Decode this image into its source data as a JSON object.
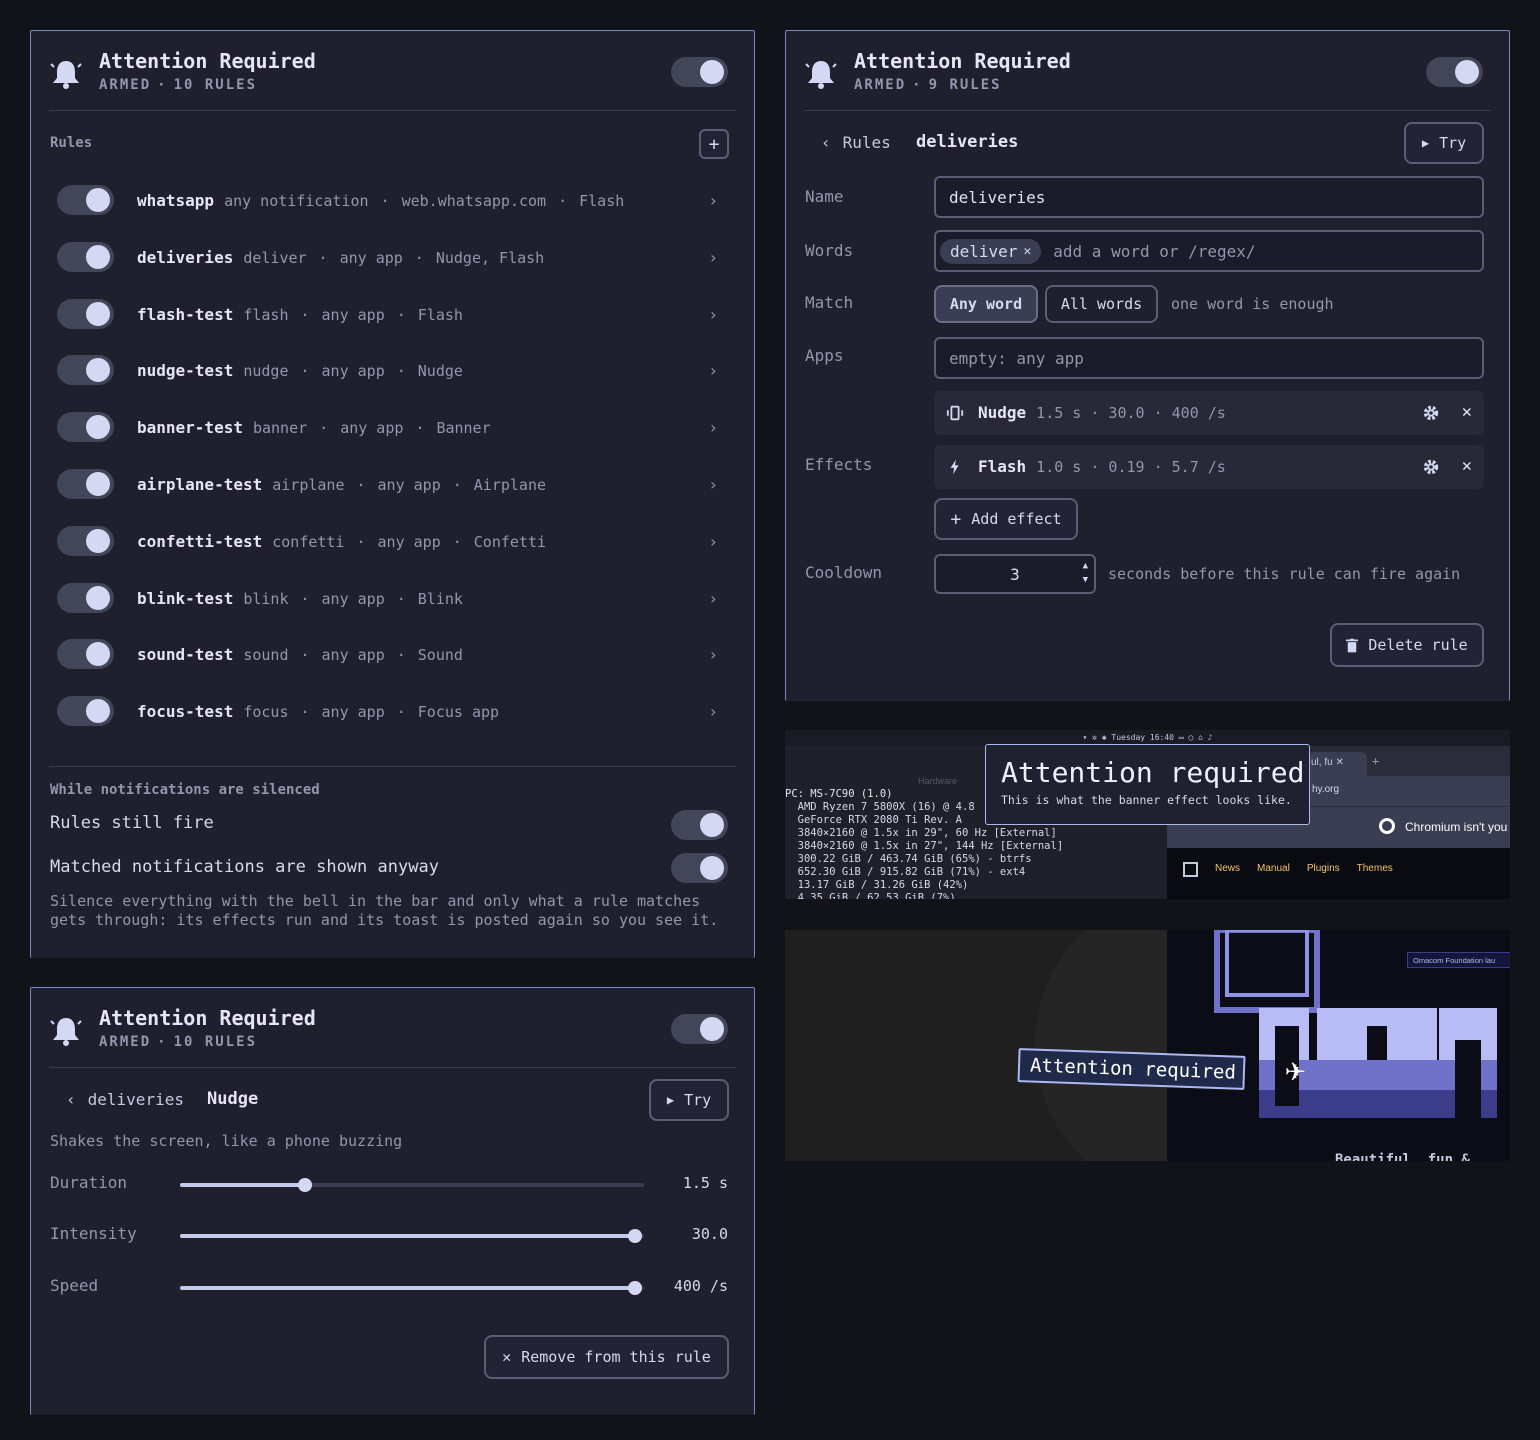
{
  "panel_rules": {
    "title": "Attention Required",
    "status": "ARMED",
    "rule_count": "10 RULES",
    "section_label": "Rules",
    "add_icon": "plus-icon",
    "rules": [
      {
        "name": "whatsapp",
        "trigger": "any notification",
        "app": "web.whatsapp.com",
        "effects": "Flash"
      },
      {
        "name": "deliveries",
        "trigger": "deliver",
        "app": "any app",
        "effects": "Nudge, Flash"
      },
      {
        "name": "flash-test",
        "trigger": "flash",
        "app": "any app",
        "effects": "Flash"
      },
      {
        "name": "nudge-test",
        "trigger": "nudge",
        "app": "any app",
        "effects": "Nudge"
      },
      {
        "name": "banner-test",
        "trigger": "banner",
        "app": "any app",
        "effects": "Banner"
      },
      {
        "name": "airplane-test",
        "trigger": "airplane",
        "app": "any app",
        "effects": "Airplane"
      },
      {
        "name": "confetti-test",
        "trigger": "confetti",
        "app": "any app",
        "effects": "Confetti"
      },
      {
        "name": "blink-test",
        "trigger": "blink",
        "app": "any app",
        "effects": "Blink"
      },
      {
        "name": "sound-test",
        "trigger": "sound",
        "app": "any app",
        "effects": "Sound"
      },
      {
        "name": "focus-test",
        "trigger": "focus",
        "app": "any app",
        "effects": "Focus app"
      }
    ],
    "silenced_header": "While notifications are silenced",
    "silenced_opt1": "Rules still fire",
    "silenced_opt2": "Matched notifications are shown anyway",
    "silenced_note_1": "Silence everything with the bell in the bar and only what a rule matches",
    "silenced_note_2": "gets through: its effects run and its toast is posted again so you see it."
  },
  "panel_edit": {
    "title": "Attention Required",
    "status": "ARMED",
    "rule_count": "9 RULES",
    "back_label": "Rules",
    "rule_name": "deliveries",
    "try_label": "Try",
    "name_label": "Name",
    "name_value": "deliveries",
    "words_label": "Words",
    "word_chip": "deliver",
    "words_placeholder": "add a word or /regex/",
    "match_label": "Match",
    "match_any": "Any word",
    "match_all": "All words",
    "match_hint": "one word is enough",
    "apps_label": "Apps",
    "apps_placeholder": "empty: any app",
    "effects_label": "Effects",
    "effects": [
      {
        "name": "Nudge",
        "params": "1.5 s · 30.0 · 400 /s",
        "icon": "vibrate-icon"
      },
      {
        "name": "Flash",
        "params": "1.0 s · 0.19 · 5.7 /s",
        "icon": "bolt-icon"
      }
    ],
    "add_effect": "Add effect",
    "cooldown_label": "Cooldown",
    "cooldown_value": "3",
    "cooldown_hint": "seconds before this rule can fire again",
    "delete_label": "Delete rule"
  },
  "panel_effect": {
    "title": "Attention Required",
    "status": "ARMED",
    "rule_count": "10 RULES",
    "back_label": "deliveries",
    "effect_name": "Nudge",
    "try_label": "Try",
    "description": "Shakes the screen, like a phone buzzing",
    "duration_label": "Duration",
    "duration_value": "1.5 s",
    "duration_level": 0.27,
    "intensity_label": "Intensity",
    "intensity_value": "30.0",
    "intensity_level": 0.98,
    "speed_label": "Speed",
    "speed_value": "400 /s",
    "speed_level": 0.98,
    "remove_label": "Remove from this rule"
  },
  "preview_banner": {
    "topbar_time": "Tuesday 16:40",
    "section": "Hardware",
    "sys_lines": [
      "PC: MS-7C90 (1.0)",
      "  AMD Ryzen 7 5800X (16) @ 4.8",
      "  GeForce RTX 2080 Ti Rev. A",
      "  3840×2160 @ 1.5x in 29\", 60 Hz [External]",
      "  3840×2160 @ 1.5x in 27\", 144 Hz [External]",
      "  300.22 GiB / 463.74 GiB (65%) - btrfs",
      "  652.30 GiB / 915.82 GiB (71%) - ext4",
      "  13.17 GiB / 31.26 GiB (42%)",
      "  4.35 GiB / 62.53 GiB (7%)"
    ],
    "banner_title": "Attention required",
    "banner_text": "This is what the banner effect looks like.",
    "browser_tab": "ul, fu",
    "browser_url": "hy.org",
    "chromium_msg": "Chromium isn't you",
    "nav": [
      "News",
      "Manual",
      "Plugins",
      "Themes"
    ]
  },
  "preview_airplane": {
    "banner_text": "Attention required",
    "corner_text": "Omacom Foundation lau",
    "bottom_text": "Beautiful, fun &"
  },
  "colors": {
    "bg": "#101318",
    "panel": "#1f1f2e",
    "border": "#7b86c4",
    "accent": "#d4d8f3"
  }
}
